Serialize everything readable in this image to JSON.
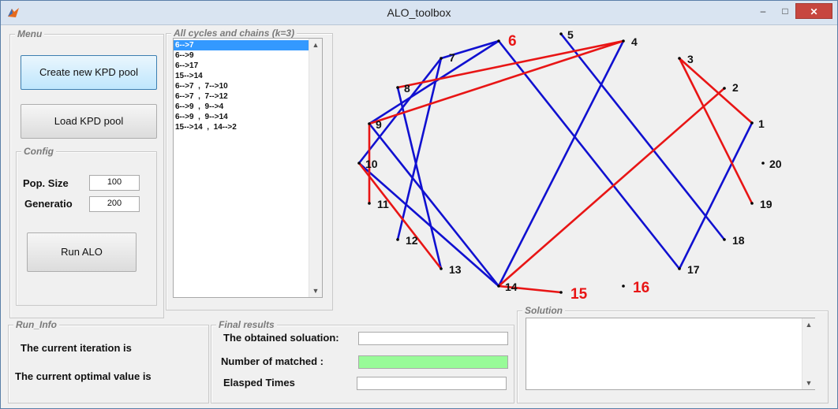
{
  "window": {
    "title": "ALO_toolbox",
    "min": "–",
    "max": "□",
    "close": "✕"
  },
  "menu": {
    "title": "Menu",
    "create_label": "Create new KPD pool",
    "load_label": "Load KPD pool",
    "config": {
      "title": "Config",
      "pop_label": "Pop. Size",
      "pop_value": "100",
      "gen_label": "Generatio",
      "gen_value": "200"
    },
    "run_label": "Run ALO"
  },
  "cycles": {
    "title": "All cycles and chains (k=3)",
    "items": [
      "6-->7",
      "6-->9",
      "6-->17",
      "15-->14",
      "6-->7  ,  7-->10",
      "6-->7  ,  7-->12",
      "6-->9  ,  9-->4",
      "6-->9  ,  9-->14",
      "15-->14  ,  14-->2"
    ],
    "selected_index": 0
  },
  "graph": {
    "nodes": [
      {
        "id": "1",
        "highlight": false
      },
      {
        "id": "2",
        "highlight": false
      },
      {
        "id": "3",
        "highlight": false
      },
      {
        "id": "4",
        "highlight": false
      },
      {
        "id": "5",
        "highlight": false
      },
      {
        "id": "6",
        "highlight": true
      },
      {
        "id": "7",
        "highlight": false
      },
      {
        "id": "8",
        "highlight": false
      },
      {
        "id": "9",
        "highlight": false
      },
      {
        "id": "10",
        "highlight": false
      },
      {
        "id": "11",
        "highlight": false
      },
      {
        "id": "12",
        "highlight": false
      },
      {
        "id": "13",
        "highlight": false
      },
      {
        "id": "14",
        "highlight": false
      },
      {
        "id": "15",
        "highlight": true
      },
      {
        "id": "16",
        "highlight": true
      },
      {
        "id": "17",
        "highlight": false
      },
      {
        "id": "18",
        "highlight": false
      },
      {
        "id": "19",
        "highlight": false
      },
      {
        "id": "20",
        "highlight": false
      }
    ],
    "edges": [
      {
        "from": "6",
        "to": "7",
        "color": "blue"
      },
      {
        "from": "6",
        "to": "9",
        "color": "blue"
      },
      {
        "from": "6",
        "to": "17",
        "color": "blue"
      },
      {
        "from": "7",
        "to": "10",
        "color": "blue"
      },
      {
        "from": "7",
        "to": "12",
        "color": "blue"
      },
      {
        "from": "5",
        "to": "18",
        "color": "blue"
      },
      {
        "from": "4",
        "to": "14",
        "color": "blue"
      },
      {
        "from": "17",
        "to": "1",
        "color": "blue"
      },
      {
        "from": "8",
        "to": "13",
        "color": "blue"
      },
      {
        "from": "9",
        "to": "14",
        "color": "blue"
      },
      {
        "from": "10",
        "to": "14",
        "color": "blue"
      },
      {
        "from": "8",
        "to": "4",
        "color": "red"
      },
      {
        "from": "9",
        "to": "4",
        "color": "red"
      },
      {
        "from": "9",
        "to": "11",
        "color": "red"
      },
      {
        "from": "10",
        "to": "13",
        "color": "red"
      },
      {
        "from": "3",
        "to": "1",
        "color": "red"
      },
      {
        "from": "3",
        "to": "19",
        "color": "red"
      },
      {
        "from": "14",
        "to": "2",
        "color": "red"
      },
      {
        "from": "14",
        "to": "15",
        "color": "red"
      }
    ],
    "colors": {
      "red": "#e81515",
      "blue": "#1010d0",
      "highlight_label": "#e81515"
    }
  },
  "run_info": {
    "title": "Run_Info",
    "iteration_label": "The current iteration is",
    "optimal_label": "The current optimal value is"
  },
  "final": {
    "title": "Final results",
    "solution_label": "The obtained soluation:",
    "solution_value": "",
    "matched_label": "Number of matched :",
    "matched_value": "",
    "elapsed_label": "Elasped Times",
    "elapsed_value": "",
    "matched_color": "#98fb98"
  },
  "solution": {
    "title": "Solution",
    "text": ""
  }
}
